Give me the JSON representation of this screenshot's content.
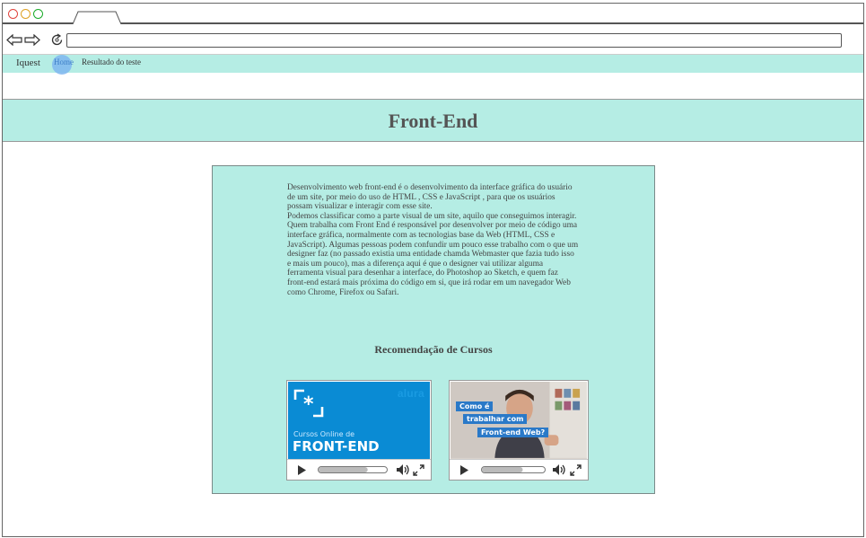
{
  "browser": {
    "url": ""
  },
  "nav": {
    "brand": "Iquest",
    "links": [
      "Home",
      "Resultado do teste"
    ]
  },
  "header": {
    "title": "Front-End"
  },
  "content": {
    "paragraph1": "Desenvolvimento web front-end é o desenvolvimento da interface gráfica do usuário de um site, por meio do uso de HTML , CSS e JavaScript , para que os usuários possam visualizar e interagir com esse site.",
    "paragraph2": "Podemos classificar como a parte visual de um site, aquilo que conseguimos interagir. Quem trabalha com Front End é responsável por desenvolver por meio de código uma interface gráfica, normalmente com as tecnologias base da Web (HTML, CSS e JavaScript). Algumas pessoas podem confundir um pouco esse trabalho com o que um designer faz (no passado existia uma entidade chamda Webmaster que fazia tudo isso e mais um pouco), mas a diferença aqui é que o designer vai utilizar alguma ferramenta visual para desenhar a interface, do Photoshop ao Sketch, e quem faz front-end estará mais próxima do código em si, que irá rodar em um navegador Web como Chrome, Firefox ou Safari.",
    "recommendation_title": "Recomendação de Cursos"
  },
  "videos": [
    {
      "watermark": "alura",
      "subtitle": "Cursos Online de",
      "title": "FRONT-END",
      "progress": 0.72
    },
    {
      "captions": [
        "Como é",
        "trabalhar com",
        "Front-end Web?"
      ],
      "progress": 0.65
    }
  ],
  "colors": {
    "accent": "#b5ede4",
    "thumb1": "#0a8bd4",
    "caption": "#2a79c8"
  }
}
